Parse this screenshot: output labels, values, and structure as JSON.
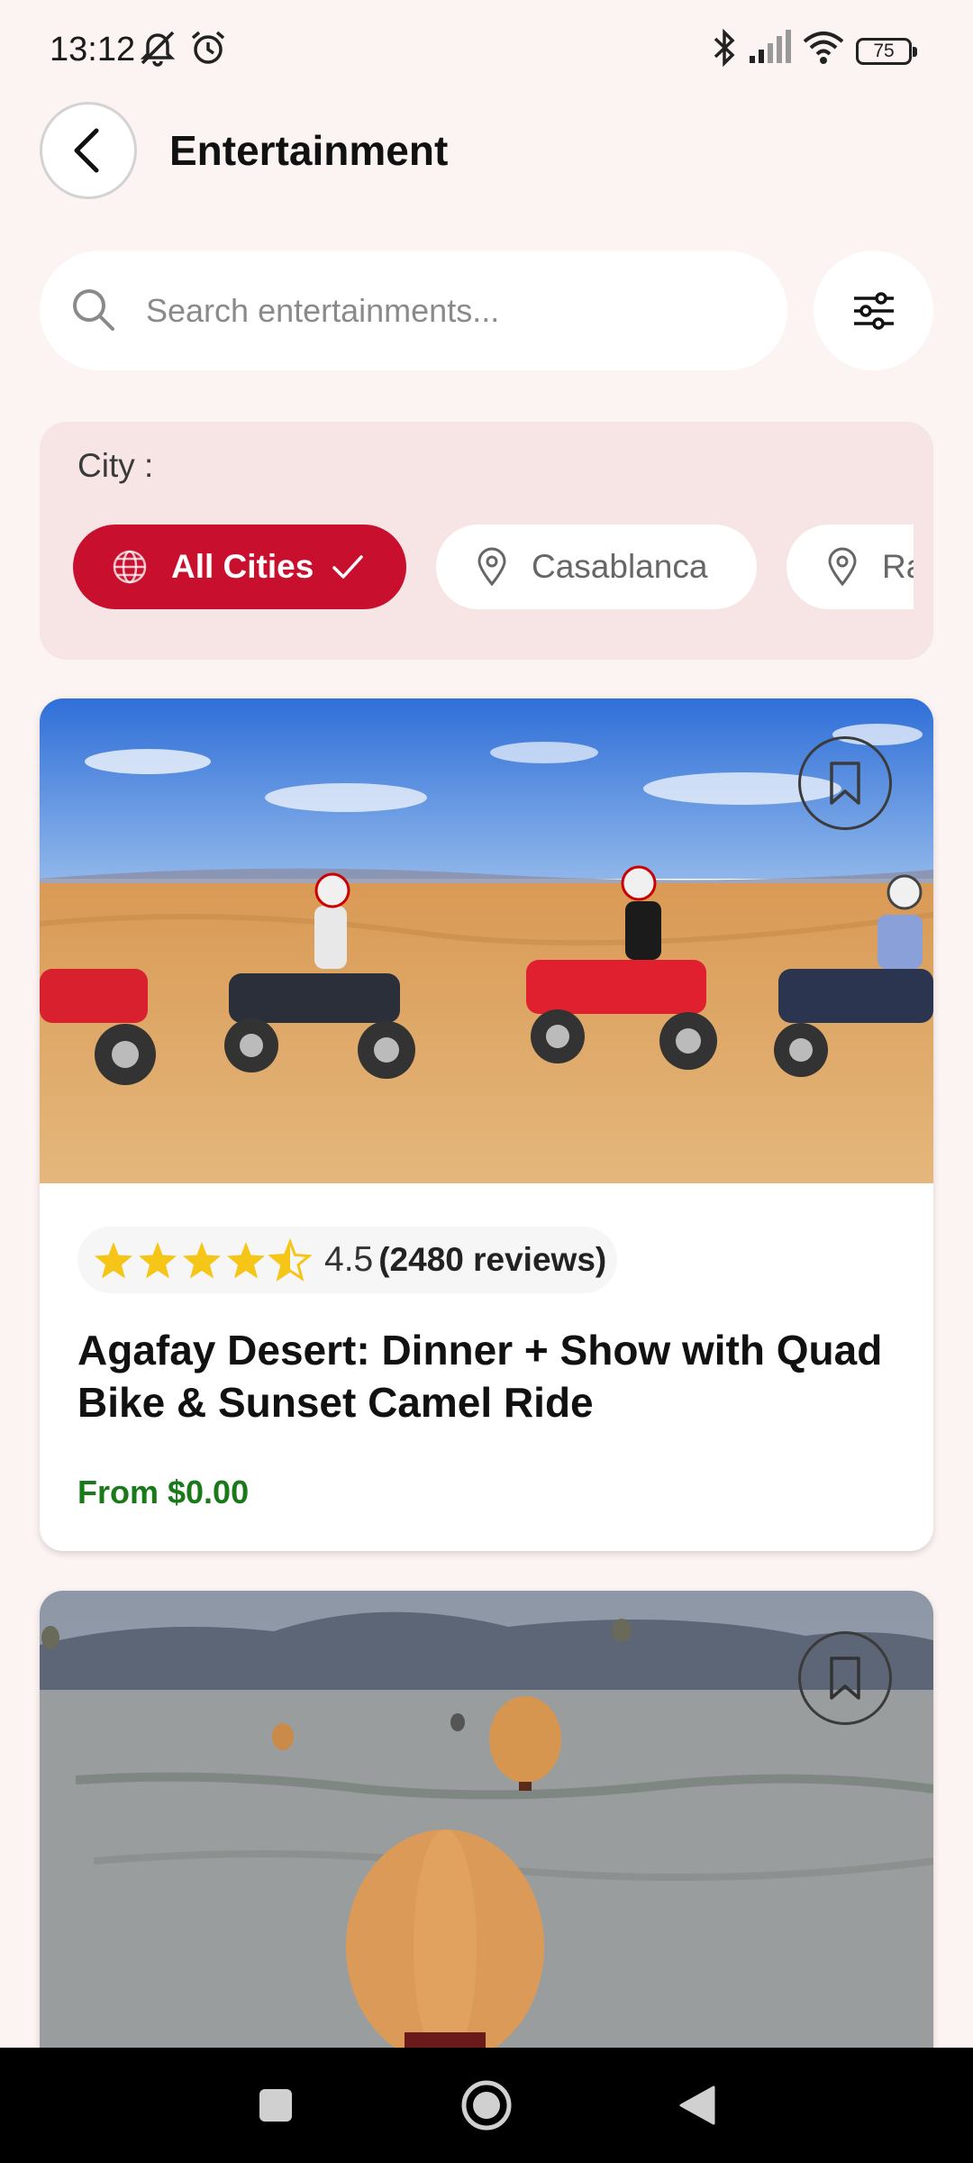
{
  "status_bar": {
    "time": "13:12",
    "battery": "75",
    "icons": [
      "mute-icon",
      "alarm-icon",
      "bluetooth-icon",
      "signal-icon",
      "wifi-icon",
      "battery-icon"
    ]
  },
  "header": {
    "title": "Entertainment",
    "back_icon": "back-arrow-icon"
  },
  "search": {
    "placeholder": "Search entertainments...",
    "value": "",
    "filter_icon": "sliders-icon"
  },
  "city_filter": {
    "label": "City :",
    "chips": [
      {
        "label": "All Cities",
        "icon": "globe-icon",
        "selected": true
      },
      {
        "label": "Casablanca",
        "icon": "location-pin-icon",
        "selected": false
      },
      {
        "label": "Ra",
        "icon": "location-pin-icon",
        "selected": false
      }
    ]
  },
  "cards": [
    {
      "image": "desert-quad-bikes-photo",
      "rating": "4.5",
      "stars": 4.5,
      "reviews": "(2480 reviews)",
      "title": "Agafay Desert: Dinner + Show with Quad Bike & Sunset Camel Ride",
      "price": "From $0.00"
    },
    {
      "image": "hot-air-balloons-photo"
    }
  ],
  "colors": {
    "accent": "#c8102e",
    "background": "#fcf3f3",
    "panel": "#f7e5e6",
    "price": "#1a7a1a",
    "star": "#f5c518"
  },
  "nav_bar": {
    "icons": [
      "recents-icon",
      "home-icon",
      "back-icon"
    ]
  }
}
